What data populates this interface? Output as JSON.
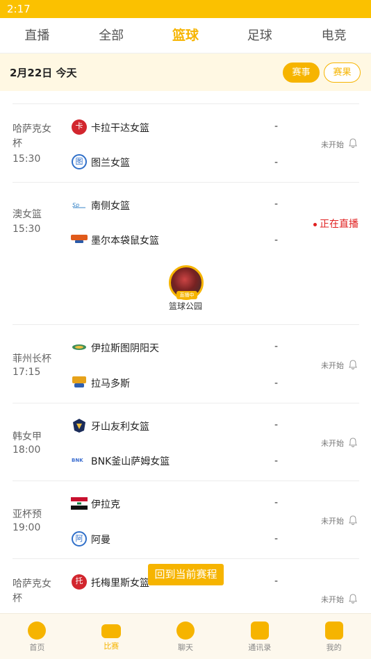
{
  "status_bar": {
    "time": "2:17"
  },
  "top_tabs": [
    "直播",
    "全部",
    "篮球",
    "足球",
    "电竞"
  ],
  "active_tab_index": 2,
  "date_bar": {
    "date": "2月22日 今天",
    "events_label": "赛事",
    "results_label": "赛果"
  },
  "matches": [
    {
      "league": "哈萨克女杯",
      "time": "15:30",
      "home": {
        "name": "卡拉干达女篮",
        "logo": "卡",
        "color": "#d2262e"
      },
      "away": {
        "name": "图兰女篮",
        "logo": "图",
        "color": "#2f6fc9"
      },
      "home_score": "-",
      "away_score": "-",
      "status": "未开始"
    },
    {
      "league": "澳女篮",
      "time": "15:30",
      "home": {
        "name": "南侧女篮",
        "logo": "",
        "color": "#3a86c8"
      },
      "away": {
        "name": "墨尔本袋鼠女篮",
        "logo": "",
        "color": "#e05a1b"
      },
      "home_score": "-",
      "away_score": "-",
      "status": "正在直播"
    },
    {
      "league": "菲州长杯",
      "time": "17:15",
      "home": {
        "name": "伊拉斯图阴阳天",
        "logo": "",
        "color": "#3f8f5b"
      },
      "away": {
        "name": "拉马多斯",
        "logo": "",
        "color": "#e6a21a"
      },
      "home_score": "-",
      "away_score": "-",
      "status": "未开始"
    },
    {
      "league": "韩女甲",
      "time": "18:00",
      "home": {
        "name": "牙山友利女篮",
        "logo": "",
        "color": "#1b2c5a"
      },
      "away": {
        "name": "BNK釜山萨姆女篮",
        "logo": "",
        "color": "#3c6ed0"
      },
      "home_score": "-",
      "away_score": "-",
      "status": "未开始"
    },
    {
      "league": "亚杯预",
      "time": "19:00",
      "home": {
        "name": "伊拉克",
        "logo": "",
        "color": "#c8102e"
      },
      "away": {
        "name": "阿曼",
        "logo": "阿",
        "color": "#2f6fc9"
      },
      "home_score": "-",
      "away_score": "-",
      "status": "未开始"
    },
    {
      "league": "哈萨克女杯",
      "time": "",
      "home": {
        "name": "托梅里斯女篮",
        "logo": "托",
        "color": "#d2262e"
      },
      "away": {
        "name": "",
        "logo": "",
        "color": "#2f6fc9"
      },
      "home_score": "-",
      "away_score": "",
      "status": "未开始"
    }
  ],
  "streamer": {
    "name": "篮球公园",
    "badge": "直播中"
  },
  "back_button": "回到当前赛程",
  "bottom_nav": [
    {
      "label": "首页",
      "icon": "home-icon"
    },
    {
      "label": "比赛",
      "icon": "match-icon"
    },
    {
      "label": "聊天",
      "icon": "chat-icon"
    },
    {
      "label": "通讯录",
      "icon": "contacts-icon"
    },
    {
      "label": "我的",
      "icon": "profile-icon"
    }
  ],
  "active_nav_index": 1,
  "colors": {
    "accent": "#f6b400",
    "live": "#e02020"
  }
}
